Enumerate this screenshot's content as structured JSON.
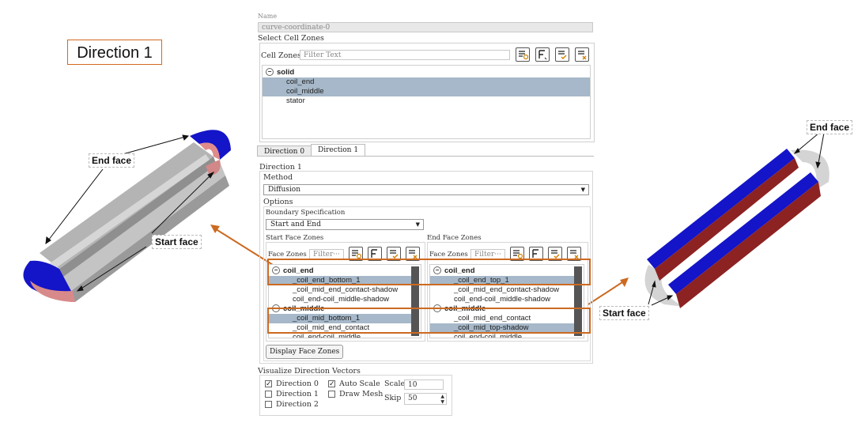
{
  "title_box": "Direction 1",
  "left_labels": {
    "end_face": "End face",
    "start_face": "Start face"
  },
  "right_labels": {
    "end_face": "End face",
    "start_face": "Start face"
  },
  "panel": {
    "name_label": "Name",
    "name_value": "curve-coordinate-0",
    "select_cell_zones": "Select Cell Zones",
    "cell_zones_label": "Cell Zones",
    "filter_placeholder": "Filter Text",
    "cell_tree": {
      "group": "solid",
      "items": [
        "coil_end",
        "coil_middle",
        "stator"
      ]
    },
    "tabs": [
      "Direction 0",
      "Direction 1"
    ],
    "section_title": "Direction 1",
    "method_label": "Method",
    "method_value": "Diffusion",
    "options_label": "Options",
    "boundary_label": "Boundary Specification",
    "boundary_value": "Start and End",
    "start_face_zones": {
      "header": "Start Face Zones",
      "label": "Face Zones",
      "filter": "Filter···",
      "groups": [
        {
          "name": "coil_end",
          "items": [
            "_coil_end_bottom_1",
            "_coil_mid_end_contact-shadow",
            "coil_end-coil_middle-shadow"
          ]
        },
        {
          "name": "coil_middle",
          "items": [
            "_coil_mid_bottom_1",
            "_coil_mid_end_contact",
            "coil_end-coil_middle"
          ]
        }
      ]
    },
    "end_face_zones": {
      "header": "End Face Zones",
      "label": "Face Zones",
      "filter": "Filter···",
      "groups": [
        {
          "name": "coil_end",
          "items": [
            "_coil_end_top_1",
            "_coil_mid_end_contact-shadow",
            "coil_end-coil_middle-shadow"
          ]
        },
        {
          "name": "coil_middle",
          "items": [
            "_coil_mid_end_contact",
            "_coil_mid_top-shadow",
            "coil_end-coil_middle"
          ]
        }
      ]
    },
    "display_button": "Display Face Zones",
    "visualize": {
      "title": "Visualize Direction Vectors",
      "dir0": "Direction 0",
      "dir1": "Direction 1",
      "dir2": "Direction 2",
      "auto_scale": "Auto Scale",
      "draw_mesh": "Draw Mesh",
      "scale_label": "Scale",
      "scale_value": "10",
      "skip_label": "Skip",
      "skip_value": "50"
    }
  },
  "colors": {
    "accent": "#cc6a21",
    "selection": "#a6b8c9",
    "coil_blue": "#1414c8",
    "coil_red": "#c06060"
  }
}
